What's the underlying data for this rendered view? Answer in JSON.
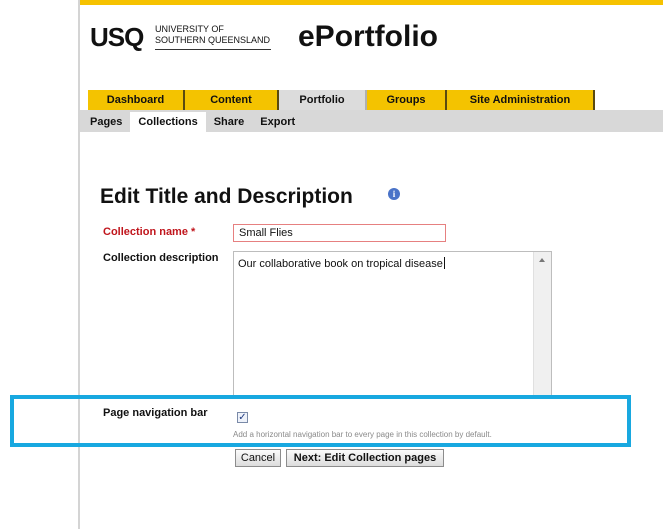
{
  "header": {
    "logo_text": "USQ",
    "university_line1": "UNIVERSITY OF",
    "university_line2": "SOUTHERN QUEENSLAND",
    "app_title": "ePortfolio"
  },
  "main_tabs": [
    {
      "label": "Dashboard",
      "active": false
    },
    {
      "label": "Content",
      "active": false
    },
    {
      "label": "Portfolio",
      "active": true
    },
    {
      "label": "Groups",
      "active": false
    },
    {
      "label": "Site Administration",
      "active": false
    }
  ],
  "sub_tabs": [
    {
      "label": "Pages",
      "active": false
    },
    {
      "label": "Collections",
      "active": true
    },
    {
      "label": "Share",
      "active": false
    },
    {
      "label": "Export",
      "active": false
    }
  ],
  "page": {
    "title": "Edit Title and Description",
    "info_icon": "info-icon"
  },
  "form": {
    "name_label": "Collection name *",
    "name_value": "Small Flies",
    "description_label": "Collection description",
    "description_value": "Our collaborative book on tropical disease",
    "nav_label": "Page navigation bar",
    "nav_checked": true,
    "nav_help": "Add a horizontal navigation bar to every page in this collection by default.",
    "cancel_label": "Cancel",
    "next_label": "Next: Edit Collection pages"
  },
  "colors": {
    "accent_yellow": "#f4c300",
    "highlight_blue": "#18a8e0",
    "required_red": "#c0151c"
  }
}
